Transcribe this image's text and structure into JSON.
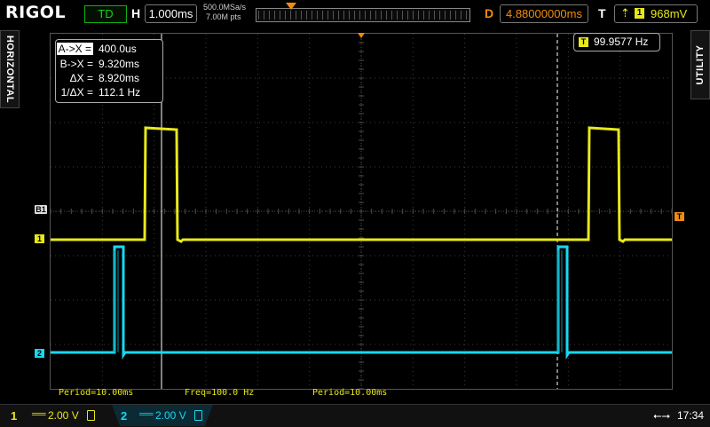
{
  "header": {
    "brand": "RIGOL",
    "run_status": "TD",
    "timebase_prefix": "H",
    "timebase": "1.000ms",
    "sample_rate": "500.0MSa/s",
    "memory_depth": "7.00M pts",
    "delay_prefix": "D",
    "delay": "4.88000000ms",
    "trigger_prefix": "T",
    "trigger_edge_icon": "rising-edge-icon",
    "trigger_channel": "1",
    "trigger_level": "968mV"
  },
  "side_tabs": {
    "left": "HORIZONTAL",
    "right": "UTILITY"
  },
  "cursor": {
    "rows": [
      {
        "label": "A->X =",
        "value": "400.0us"
      },
      {
        "label": "B->X =",
        "value": "9.320ms"
      },
      {
        "label": "ΔX =",
        "value": "8.920ms"
      },
      {
        "label": "1/ΔX =",
        "value": "112.1 Hz"
      }
    ]
  },
  "frequency_counter": {
    "channel": "T",
    "value": "99.9577 Hz"
  },
  "markers": {
    "b1": "B1",
    "ch1": "1",
    "ch2": "2",
    "trigger": "T"
  },
  "measurements": [
    {
      "text": "Period=10.00ms"
    },
    {
      "text": "Freq=100.0 Hz"
    },
    {
      "text": "Period=10.00ms"
    }
  ],
  "footer": {
    "ch1": {
      "num": "1",
      "coupling": "══",
      "scale": "2.00 V"
    },
    "ch2": {
      "num": "2",
      "coupling": "══",
      "scale": "2.00 V"
    },
    "usb_icon": "usb-icon",
    "clock": "17:34"
  },
  "colors": {
    "ch1": "#e8e81a",
    "ch2": "#18d8f0",
    "trigger": "#f08c12",
    "graticule": "#3c3c3c"
  }
}
